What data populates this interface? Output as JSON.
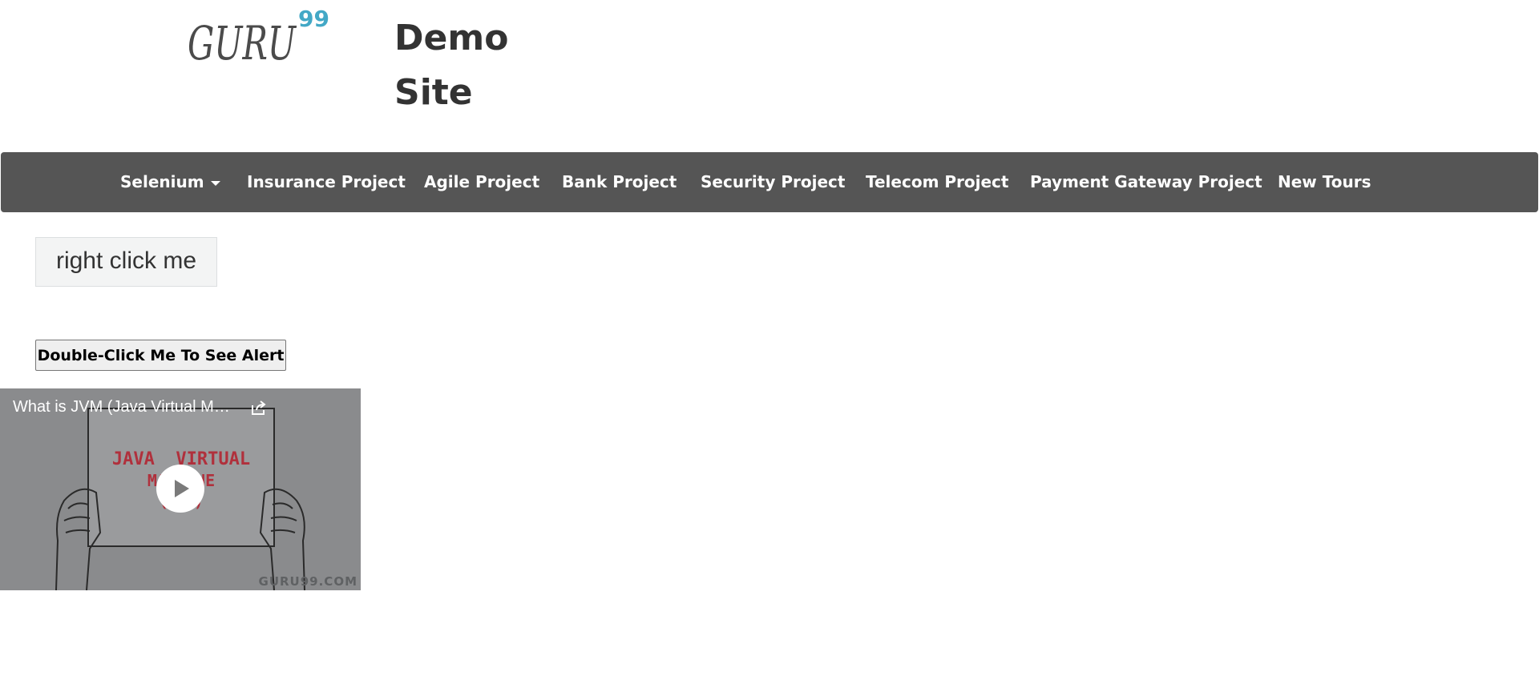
{
  "logo": {
    "brand": "GURU",
    "superscript": "99",
    "colors": {
      "text": "#4b4b4b",
      "accent": "#43a8c6"
    }
  },
  "site_title": "Demo Site",
  "nav": {
    "background": "#555555",
    "items": [
      {
        "label": "Selenium",
        "has_dropdown": true
      },
      {
        "label": "Insurance Project"
      },
      {
        "label": "Agile Project"
      },
      {
        "label": "Bank Project"
      },
      {
        "label": "Security Project"
      },
      {
        "label": "Telecom Project"
      },
      {
        "label": "Payment Gateway Project"
      },
      {
        "label": "New Tours"
      }
    ]
  },
  "context_button": {
    "label": "right click me"
  },
  "double_click_button": {
    "label": "Double-Click Me To See Alert"
  },
  "video": {
    "title": "What is JVM (Java Virtual Machine)",
    "sign_line1": "JAVA  VIRTUAL",
    "sign_line2": "MACHINE",
    "sign_line3": "(JVM)",
    "watermark": "GURU99.COM",
    "icons": [
      "share-icon",
      "play-icon"
    ]
  }
}
